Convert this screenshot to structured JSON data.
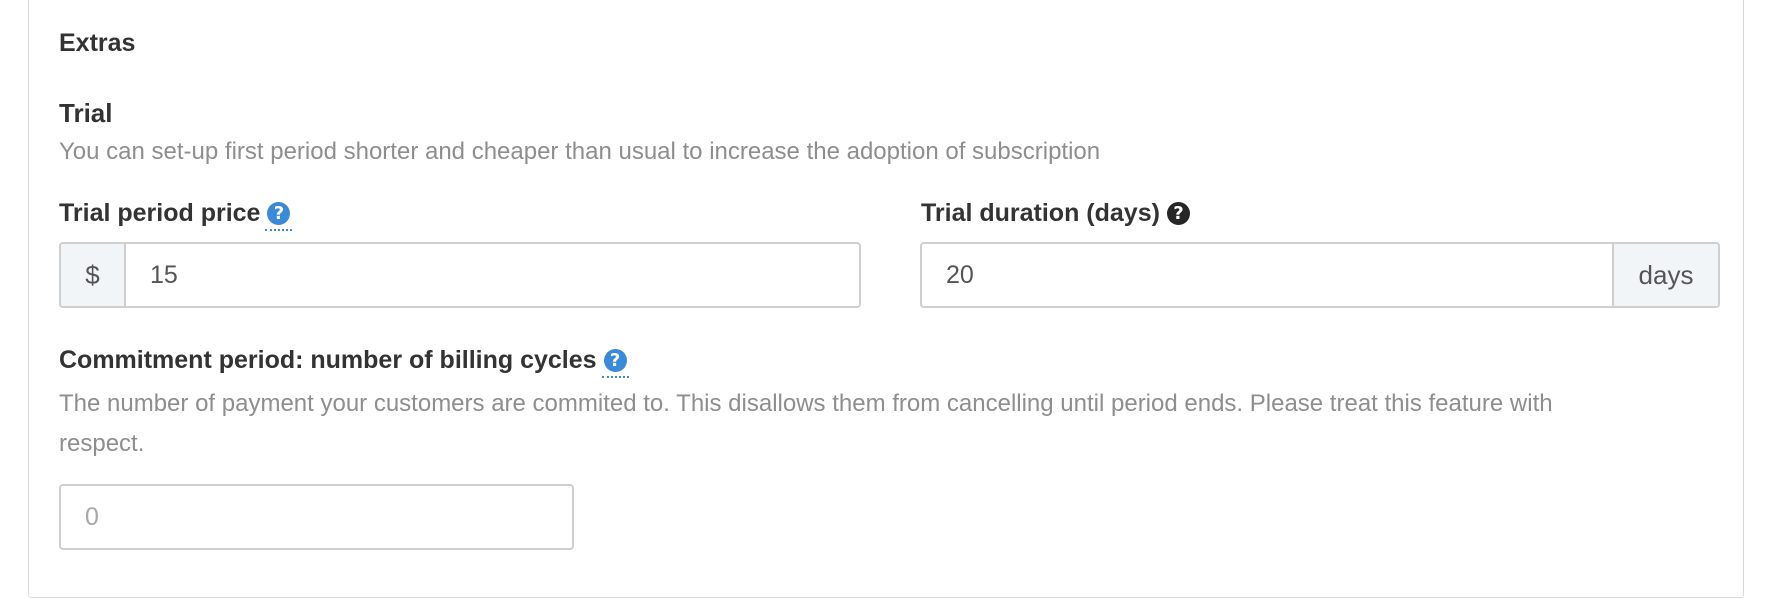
{
  "section": {
    "title": "Extras"
  },
  "trial": {
    "title": "Trial",
    "description": "You can set-up first period shorter and cheaper than usual to increase the adoption of subscription",
    "price_field": {
      "label": "Trial period price",
      "help_icon": "question-circle-icon",
      "prefix": "$",
      "value": "15"
    },
    "duration_field": {
      "label": "Trial duration (days)",
      "help_icon": "question-circle-icon",
      "value": "20",
      "suffix": "days"
    }
  },
  "commitment": {
    "label": "Commitment period: number of billing cycles",
    "help_icon": "question-circle-icon",
    "description_line1": "The number of payment your customers are commited to. This disallows them from cancelling until period ends. Please treat this feature with",
    "description_line2": "respect.",
    "placeholder": "0",
    "value": ""
  },
  "colors": {
    "help_icon_blue": "#3b8ad9",
    "help_icon_dark": "#262626",
    "muted_text": "#8e8e8e",
    "addon_background": "#f1f5f7"
  }
}
